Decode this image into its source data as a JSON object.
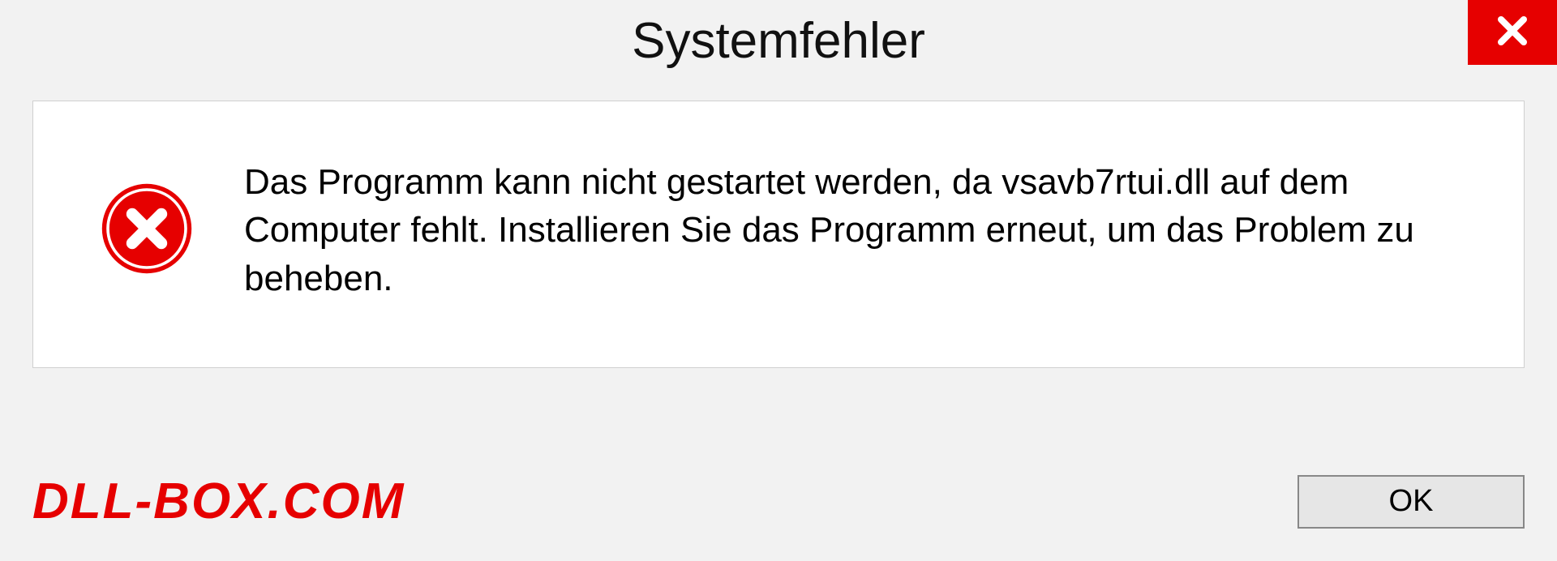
{
  "dialog": {
    "title": "Systemfehler",
    "message": "Das Programm kann nicht gestartet werden, da vsavb7rtui.dll auf dem Computer fehlt. Installieren Sie das Programm erneut, um das Problem zu beheben.",
    "ok_label": "OK"
  },
  "watermark": "DLL-BOX.COM",
  "colors": {
    "accent_red": "#e60000",
    "background": "#f2f2f2",
    "panel": "#ffffff"
  }
}
